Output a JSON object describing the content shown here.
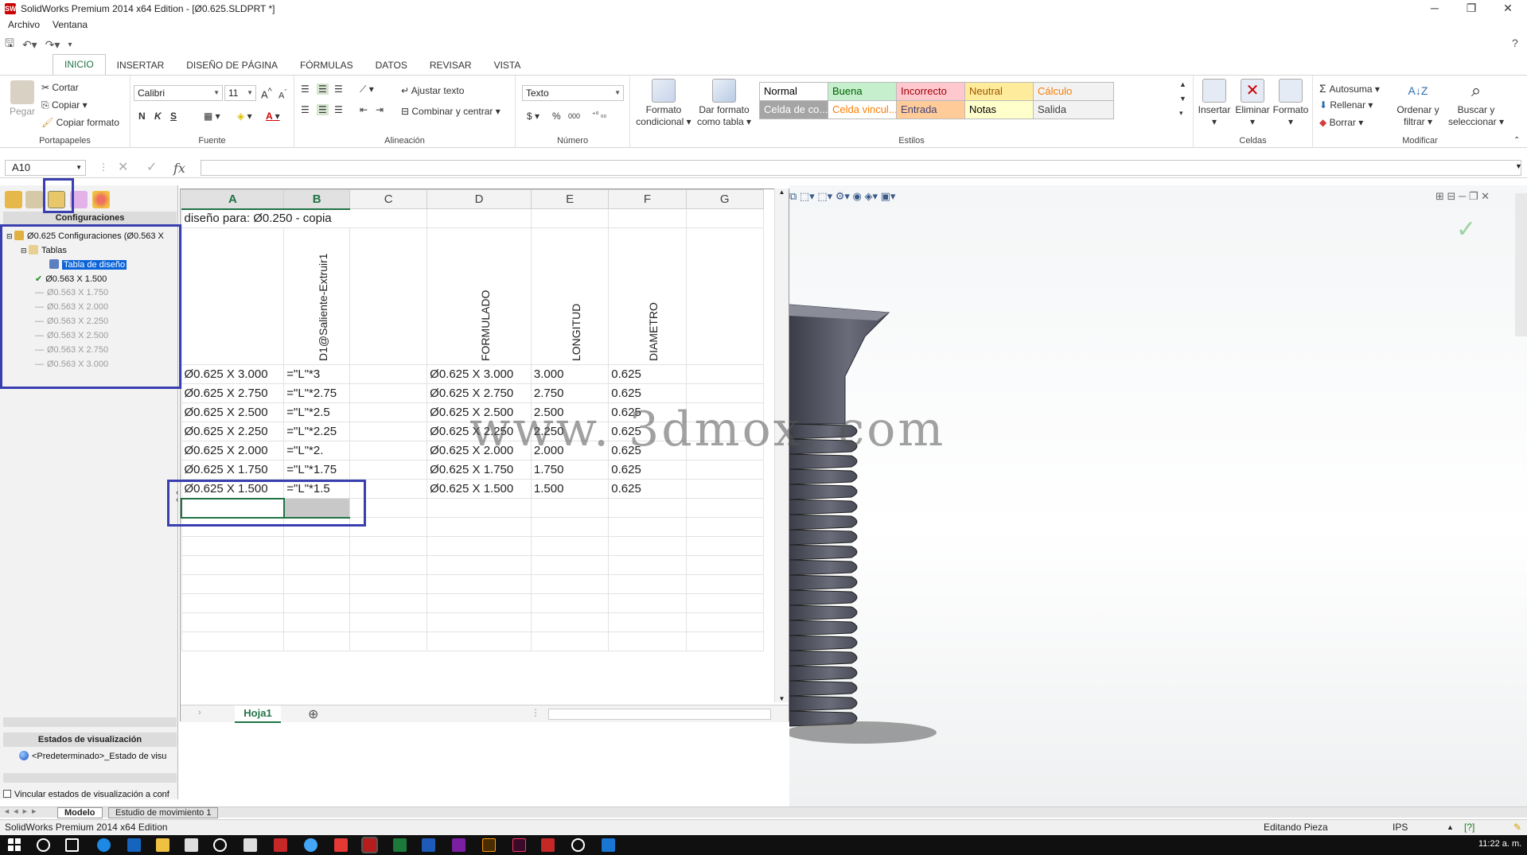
{
  "window": {
    "title": "SolidWorks Premium 2014 x64 Edition - [Ø0.625.SLDPRT *]",
    "app_icon": "solidworks-logo"
  },
  "menu": [
    "Archivo",
    "Ventana"
  ],
  "ribbon": {
    "tabs": [
      {
        "label": "INICIO",
        "active": true
      },
      {
        "label": "INSERTAR"
      },
      {
        "label": "DISEÑO DE PÁGINA"
      },
      {
        "label": "FÓRMULAS"
      },
      {
        "label": "DATOS"
      },
      {
        "label": "REVISAR"
      },
      {
        "label": "VISTA"
      }
    ],
    "clipboard": {
      "paste": "Pegar",
      "cut": "Cortar",
      "copy": "Copiar",
      "format_painter": "Copiar formato",
      "label": "Portapapeles"
    },
    "font": {
      "name": "Calibri",
      "size": "11",
      "bold": "N",
      "italic": "K",
      "underline": "S",
      "label": "Fuente"
    },
    "alignment": {
      "wrap": "Ajustar texto",
      "merge": "Combinar y centrar",
      "label": "Alineación"
    },
    "number": {
      "format": "Texto",
      "currency": "$",
      "percent": "%",
      "thousands": "000",
      "label": "Número"
    },
    "conditional": {
      "label1": "Formato",
      "label2": "condicional"
    },
    "astable": {
      "label1": "Dar formato",
      "label2": "como tabla"
    },
    "styles": {
      "label": "Estilos",
      "items": [
        {
          "name": "Normal",
          "bg": "#ffffff",
          "fg": "#000000"
        },
        {
          "name": "Buena",
          "bg": "#c6efce",
          "fg": "#006100"
        },
        {
          "name": "Incorrecto",
          "bg": "#ffc7ce",
          "fg": "#9c0006"
        },
        {
          "name": "Neutral",
          "bg": "#ffeb9c",
          "fg": "#9c5700"
        },
        {
          "name": "Cálculo",
          "bg": "#f2f2f2",
          "fg": "#fa7d00"
        },
        {
          "name": "Celda de co...",
          "bg": "#a5a5a5",
          "fg": "#ffffff"
        },
        {
          "name": "Celda vincul...",
          "bg": "#ffffff",
          "fg": "#fa7d00"
        },
        {
          "name": "Entrada",
          "bg": "#ffcc99",
          "fg": "#3f3f76"
        },
        {
          "name": "Notas",
          "bg": "#ffffcc",
          "fg": "#000000"
        },
        {
          "name": "Salida",
          "bg": "#f2f2f2",
          "fg": "#3f3f3f"
        }
      ]
    },
    "cells": {
      "insert": "Insertar",
      "delete": "Eliminar",
      "format": "Formato",
      "label": "Celdas"
    },
    "editing": {
      "autosum": "Autosuma",
      "fill": "Rellenar",
      "clear": "Borrar",
      "sort1": "Ordenar y",
      "sort2": "filtrar",
      "find1": "Buscar y",
      "find2": "seleccionar",
      "label": "Modificar"
    }
  },
  "formula_bar": {
    "name_box": "A10",
    "fx": "fx",
    "value": ""
  },
  "feature_manager": {
    "header": "Configuraciones",
    "root": "Ø0.625 Configuraciones  (Ø0.563 X",
    "tables": "Tablas",
    "design_table": "Tabla de diseño",
    "configs": [
      {
        "name": "Ø0.563 X 1.500",
        "active": true
      },
      {
        "name": "Ø0.563 X 1.750",
        "active": false
      },
      {
        "name": "Ø0.563 X 2.000",
        "active": false
      },
      {
        "name": "Ø0.563 X 2.250",
        "active": false
      },
      {
        "name": "Ø0.563 X 2.500",
        "active": false
      },
      {
        "name": "Ø0.563 X 2.750",
        "active": false
      },
      {
        "name": "Ø0.563 X 3.000",
        "active": false
      }
    ],
    "display_states": {
      "header": "Estados de visualización",
      "item": "<Predeterminado>_Estado de visu"
    },
    "link_checkbox": "Vincular estados de visualización a conf"
  },
  "sheet": {
    "columns": [
      "A",
      "B",
      "C",
      "D",
      "E",
      "F",
      "G"
    ],
    "title": "diseño para: Ø0.250 - copia",
    "rotated_headers": {
      "B": "D1@Saliente-Extruir1",
      "D": "FORMULADO",
      "E": "LONGITUD",
      "F": "DIAMETRO"
    },
    "rows": [
      [
        "Ø0.625 X 3.000",
        "=\"L\"*3",
        "",
        "Ø0.625 X 3.000",
        "3.000",
        "0.625",
        ""
      ],
      [
        "Ø0.625 X 2.750",
        "=\"L\"*2.75",
        "",
        "Ø0.625 X 2.750",
        "2.750",
        "0.625",
        ""
      ],
      [
        "Ø0.625 X 2.500",
        "=\"L\"*2.5",
        "",
        "Ø0.625 X 2.500",
        "2.500",
        "0.625",
        ""
      ],
      [
        "Ø0.625 X 2.250",
        "=\"L\"*2.25",
        "",
        "Ø0.625 X 2.250",
        "2.250",
        "0.625",
        ""
      ],
      [
        "Ø0.625 X 2.000",
        "=\"L\"*2.",
        "",
        "Ø0.625 X 2.000",
        "2.000",
        "0.625",
        ""
      ],
      [
        "Ø0.625 X 1.750",
        "=\"L\"*1.75",
        "",
        "Ø0.625 X 1.750",
        "1.750",
        "0.625",
        ""
      ],
      [
        "Ø0.625 X 1.500",
        "=\"L\"*1.5",
        "",
        "Ø0.625 X 1.500",
        "1.500",
        "0.625",
        ""
      ]
    ],
    "sheet_tab": "Hoja1",
    "add_sheet": "⊕"
  },
  "watermark": "www. 3dmox. com",
  "bottom_tabs": {
    "model": "Modelo",
    "motion": "Estudio de movimiento 1"
  },
  "status": {
    "left": "SolidWorks Premium 2014 x64 Edition",
    "mode": "Editando Pieza",
    "units": "IPS",
    "time": "11:22 a. m."
  },
  "colors": {
    "accent": "#217346",
    "highlight_box": "#3a3fb0",
    "selection": "#0a64d8"
  }
}
